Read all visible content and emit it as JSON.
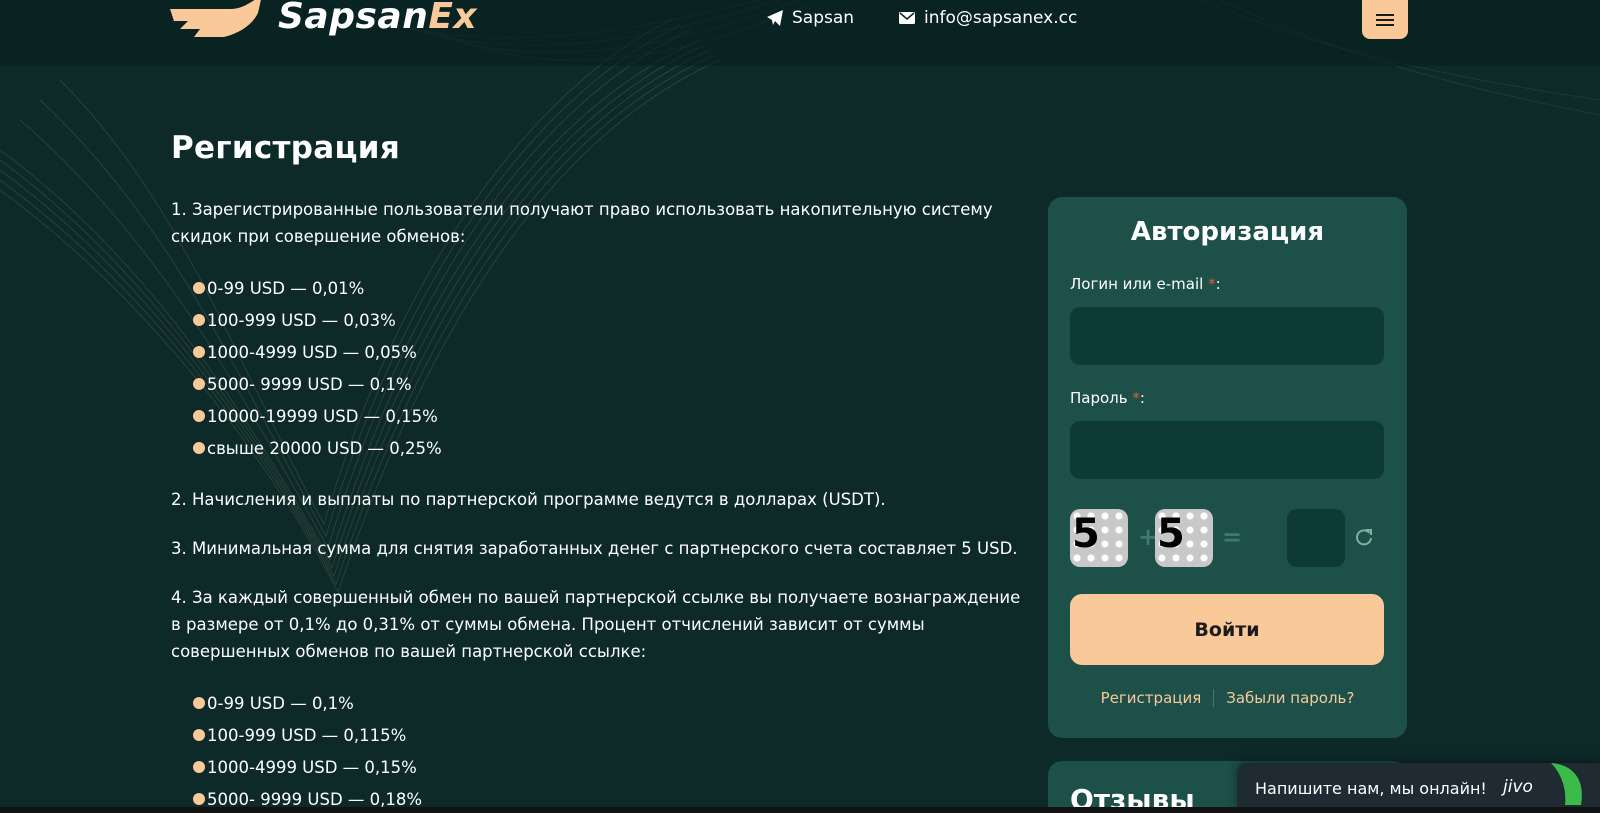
{
  "header": {
    "logo_text_main": "Sapsan",
    "logo_text_accent": "Ex",
    "telegram_label": "Sapsan",
    "email_label": "info@sapsanex.cc"
  },
  "page": {
    "title": "Регистрация",
    "para1": "1. Зарегистрированные пользователи получают право использовать накопительную систему скидок при совершение обменов:",
    "discounts": [
      "0-99 USD — 0,01%",
      "100-999 USD — 0,03%",
      "1000-4999 USD — 0,05%",
      "5000- 9999 USD — 0,1%",
      "10000-19999 USD — 0,15%",
      "свыше 20000 USD — 0,25%"
    ],
    "para2": "2. Начисления и выплаты по партнерской программе ведутся в долларах (USDT).",
    "para3": "3. Минимальная сумма для снятия заработанных денег с партнерского счета составляет 5 USD.",
    "para4": "4. За каждый совершенный обмен по вашей партнерской ссылке вы получаете вознаграждение в размере от 0,1% до 0,31% от суммы обмена. Процент отчислений зависит от суммы совершенных обменов по вашей партнерской ссылке:",
    "rewards": [
      "0-99 USD — 0,1%",
      "100-999 USD — 0,115%",
      "1000-4999 USD — 0,15%",
      "5000- 9999 USD — 0,18%"
    ]
  },
  "auth": {
    "title": "Авторизация",
    "login_label": "Логин или e-mail",
    "password_label": "Пароль",
    "required_mark": "*",
    "colon": ":",
    "captcha_a": "5",
    "captcha_op": "+",
    "captcha_b": "5",
    "captcha_eq": "=",
    "login_value": "",
    "password_value": "",
    "captcha_value": "",
    "submit_label": "Войти",
    "register_link": "Регистрация",
    "forgot_link": "Забыли пароль?"
  },
  "reviews": {
    "title": "Отзывы"
  },
  "chat": {
    "label": "Напишите нам, мы онлайн!",
    "brand": "jivo"
  },
  "colors": {
    "background": "#0d2a28",
    "card": "#1c5049",
    "input": "#0e3a36",
    "accent": "#f9c99a"
  },
  "icons": [
    "logo-falcon-icon",
    "telegram-icon",
    "mail-icon",
    "menu-icon",
    "refresh-icon",
    "jivo-leaf-icon"
  ]
}
